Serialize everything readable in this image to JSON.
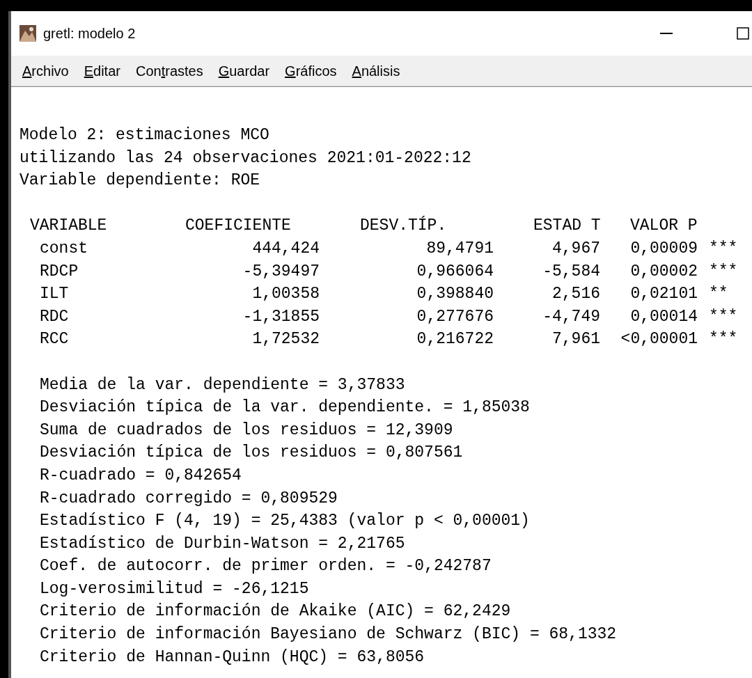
{
  "window": {
    "title": "gretl: modelo 2"
  },
  "menu": [
    {
      "key": "A",
      "after": "rchivo"
    },
    {
      "key": "E",
      "after": "ditar"
    },
    {
      "before": "Con",
      "key": "t",
      "after": "rastes"
    },
    {
      "key": "G",
      "after": "uardar"
    },
    {
      "key": "G",
      "after": "ráficos"
    },
    {
      "key": "A",
      "after": "nálisis"
    }
  ],
  "header_lines": [
    "Modelo 2: estimaciones MCO",
    "utilizando las 24 observaciones 2021:01-2022:12",
    "Variable dependiente: ROE"
  ],
  "table": {
    "columns": [
      "VARIABLE",
      "COEFICIENTE",
      "DESV.TÍP.",
      "ESTAD T",
      "VALOR P"
    ],
    "rows": [
      [
        "const",
        "444,424",
        "89,4791",
        "4,967",
        "0,00009",
        "***"
      ],
      [
        "RDCP",
        "-5,39497",
        "0,966064",
        "-5,584",
        "0,00002",
        "***"
      ],
      [
        "ILT",
        "1,00358",
        "0,398840",
        "2,516",
        "0,02101",
        "**"
      ],
      [
        "RDC",
        "-1,31855",
        "0,277676",
        "-4,749",
        "0,00014",
        "***"
      ],
      [
        "RCC",
        "1,72532",
        "0,216722",
        "7,961",
        "<0,00001",
        "***"
      ]
    ]
  },
  "stats": [
    "Media de la var. dependiente = 3,37833",
    "Desviación típica de la var. dependiente. = 1,85038",
    "Suma de cuadrados de los residuos = 12,3909",
    "Desviación típica de los residuos = 0,807561",
    "R-cuadrado = 0,842654",
    "R-cuadrado corregido = 0,809529",
    "Estadístico F (4, 19) = 25,4383 (valor p < 0,00001)",
    "Estadístico de Durbin-Watson = 2,21765",
    "Coef. de autocorr. de primer orden. = -0,242787",
    "Log-verosimilitud = -26,1215",
    "Criterio de información de Akaike (AIC) = 62,2429",
    "Criterio de información Bayesiano de Schwarz (BIC) = 68,1332",
    "Criterio de Hannan-Quinn (HQC) = 63,8056"
  ]
}
